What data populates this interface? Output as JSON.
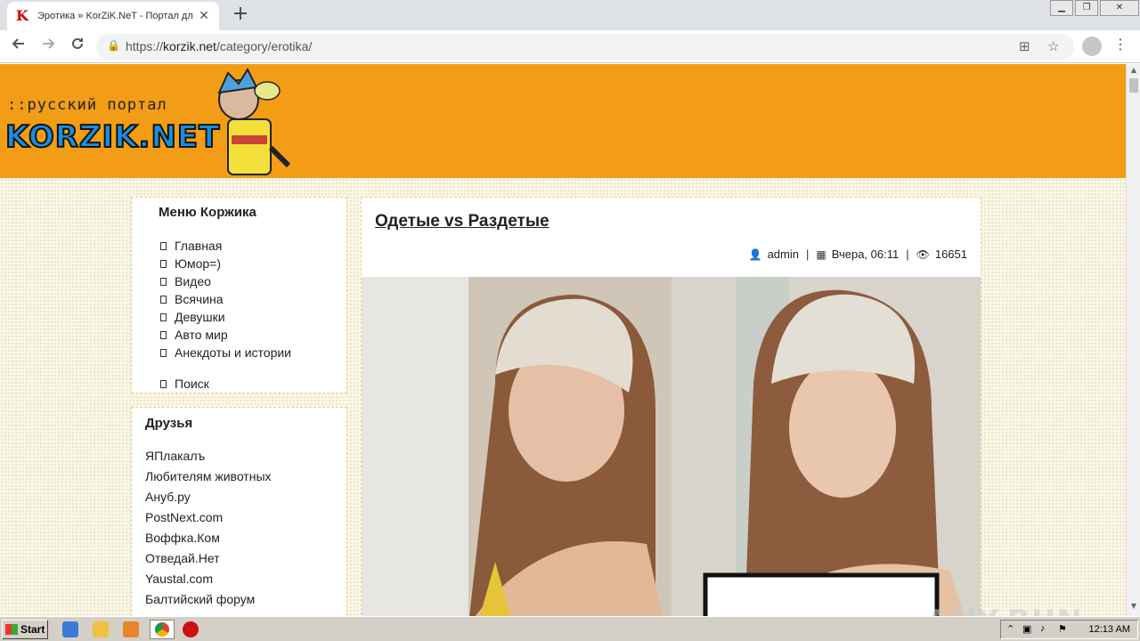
{
  "browser": {
    "tab_title": "Эротика » KorZiK.NeT - Портал для",
    "tab_close": "✕",
    "new_tab": "+",
    "url_scheme": "https://",
    "url_host": "korzik.net",
    "url_path": "/category/erotika/"
  },
  "header": {
    "logo_tagline": "::русский портал",
    "logo_name": "KORZIK.NET"
  },
  "menu": {
    "title": "Меню Коржика",
    "items": [
      "Главная",
      "Юмор=)",
      "Видео",
      "Всячина",
      "Девушки",
      "Авто мир",
      "Анекдоты и истории"
    ],
    "search": "Поиск"
  },
  "friends": {
    "title": "Друзья",
    "items": [
      "ЯПлакалъ",
      "Любителям животных",
      "Ануб.ру",
      "PostNext.com",
      "Воффка.Ком",
      "Отведай.Нет",
      "Yaustal.com",
      "Балтийский форум"
    ]
  },
  "article": {
    "title": "Одетые vs Раздетые",
    "author": "admin",
    "date": "Вчера, 06:11",
    "views": "16651"
  },
  "watermark": "ANY.RUN",
  "taskbar": {
    "start_label": "Start",
    "clock": "12:13 AM"
  },
  "colors": {
    "header_bg": "#f29d15",
    "page_bg": "#fbf7e6"
  }
}
